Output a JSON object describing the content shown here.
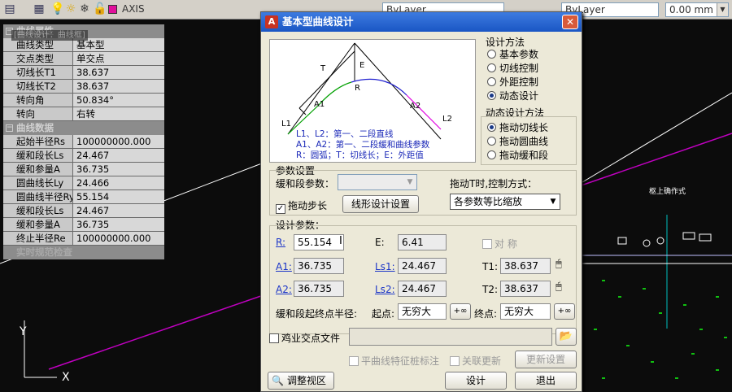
{
  "toolbar": {
    "layer_name": "AXIS",
    "linetype_left": "ByLayer",
    "linetype_right": "ByLayer",
    "lineweight": "0.00 mm"
  },
  "properties": {
    "tooltip": "[曲线设计：曲线框]",
    "groups": [
      {
        "header": "曲线属性",
        "rows": [
          {
            "k": "曲线类型",
            "v": "基本型"
          },
          {
            "k": "交点类型",
            "v": "单交点"
          },
          {
            "k": "切线长T1",
            "v": "38.637"
          },
          {
            "k": "切线长T2",
            "v": "38.637"
          },
          {
            "k": "转向角",
            "v": "50.834°"
          },
          {
            "k": "转向",
            "v": "右转"
          }
        ]
      },
      {
        "header": "曲线数据",
        "rows": [
          {
            "k": "起始半径Rs",
            "v": "100000000.000"
          },
          {
            "k": "缓和段长Ls",
            "v": "24.467"
          },
          {
            "k": "缓和参量A",
            "v": "36.735"
          },
          {
            "k": "圆曲线长Ly",
            "v": "24.466"
          },
          {
            "k": "圆曲线半径Ry",
            "v": "55.154"
          },
          {
            "k": "缓和段长Ls",
            "v": "24.467"
          },
          {
            "k": "缓和参量A",
            "v": "36.735"
          },
          {
            "k": "终止半径Re",
            "v": "100000000.000"
          }
        ]
      }
    ],
    "footer": "实时规范检查"
  },
  "cad": {
    "axis_y": "Y",
    "axis_x": "X",
    "label": "枢上确作式"
  },
  "dialog": {
    "title": "基本型曲线设计",
    "diagram": {
      "labels": {
        "T": "T",
        "E": "E",
        "R": "R",
        "A1": "A1",
        "A2": "A2",
        "L1": "L1",
        "L2": "L2"
      },
      "legend": [
        "L1、L2：第一、二段直线",
        "A1、A2：第一、二段缓和曲线参数",
        "R：圆弧；T：切线长；E：外距值"
      ]
    },
    "design_method": {
      "title": "设计方法",
      "options": [
        "基本参数",
        "切线控制",
        "外距控制",
        "动态设计"
      ],
      "selected": 3
    },
    "dynamic_method": {
      "title": "动态设计方法",
      "options": [
        "拖动切线长",
        "拖动圆曲线",
        "拖动缓和段"
      ],
      "selected": 0
    },
    "param_settings": {
      "title": "参数设置",
      "transition_label": "缓和段参数：",
      "transition_value": "",
      "drag_step_label": "拖动步长",
      "drag_step_checked": true,
      "linear_btn": "线形设计设置",
      "drag_control_label": "拖动T时,控制方式：",
      "drag_control_value": "各参数等比缩放"
    },
    "design_params": {
      "title": "设计参数：",
      "R_label": "R:",
      "R_value": "55.154",
      "E_label": "E:",
      "E_value": "6.41",
      "sym_label": "对 称",
      "A1_label": "A1:",
      "A1_value": "36.735",
      "Ls1_label": "Ls1:",
      "Ls1_value": "24.467",
      "T1_label": "T1:",
      "T1_value": "38.637",
      "A2_label": "A2:",
      "A2_value": "36.735",
      "Ls2_label": "Ls2:",
      "Ls2_value": "24.467",
      "T2_label": "T2:",
      "T2_value": "38.637",
      "radius_label": "缓和段起终点半径:",
      "start_label": "起点:",
      "start_value": "无穷大",
      "end_label": "终点:",
      "end_value": "无穷大",
      "infinity_btn": "+∞"
    },
    "file": {
      "label": "鸡业交点文件",
      "value": ""
    },
    "flat_curve_label": "平曲线特征桩标注",
    "linked_update_label": "关联更新",
    "update_settings_btn": "更新设置",
    "adjust_view_btn": "调整视区",
    "design_btn": "设计",
    "exit_btn": "退出"
  }
}
